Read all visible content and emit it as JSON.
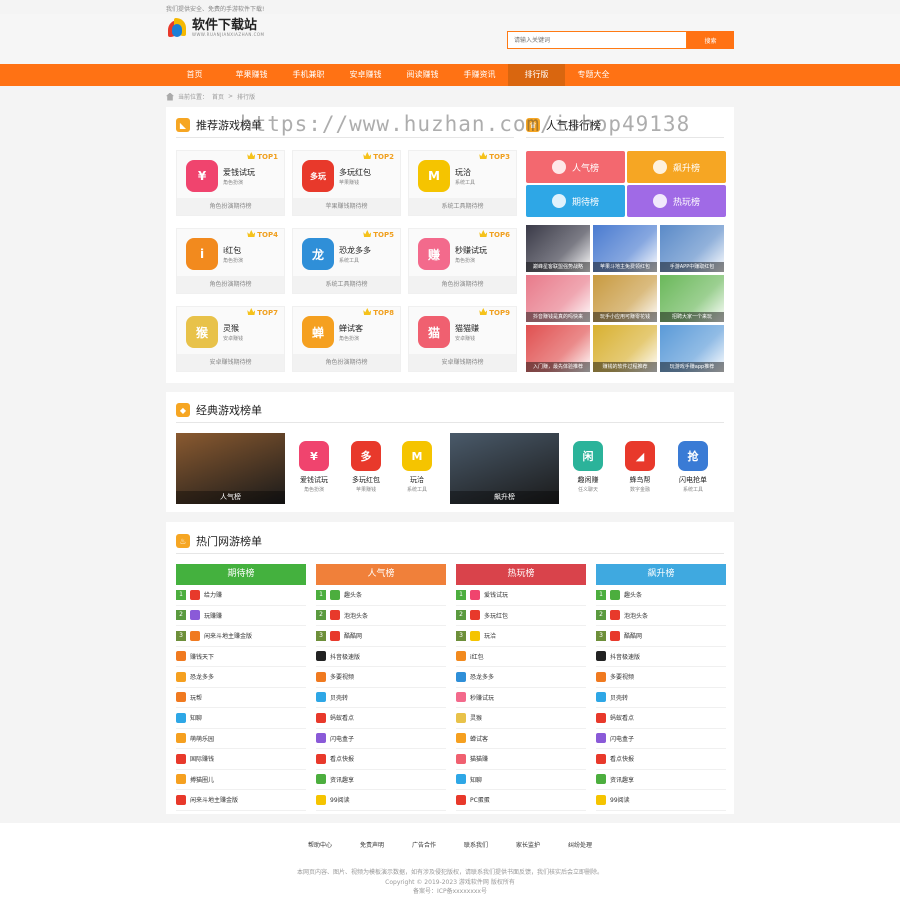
{
  "topnote": "我们提供安全、免费的手游软件下载!",
  "logo": {
    "title": "软件下载站",
    "subtitle": "WWW.RUANJIANXIAZHAN.COM"
  },
  "search": {
    "placeholder": "请输入关键词",
    "button": "搜索"
  },
  "nav": [
    "首页",
    "苹果赚钱",
    "手机兼职",
    "安卓赚钱",
    "阅读赚钱",
    "手赚资讯",
    "排行版",
    "专题大全"
  ],
  "nav_active": "排行版",
  "breadcrumb": {
    "label": "当前位置：",
    "home": "首页",
    "sep": ">",
    "current": "排行版"
  },
  "watermark": "https://www.huzhan.com/ishop49138",
  "recommend": {
    "title": "推荐游戏榜单",
    "cards": [
      {
        "rank": "TOP1",
        "name": "爱钱试玩",
        "sub": "角色扮演",
        "footer": "角色扮演期待榜",
        "icon": "wallet-icon",
        "color": "#f0446e",
        "glyph": "¥"
      },
      {
        "rank": "TOP2",
        "name": "多玩红包",
        "sub": "苹果赚钱",
        "footer": "苹果赚钱期待榜",
        "icon": "red-envelope-icon",
        "color": "#e8392b",
        "glyph": "多玩"
      },
      {
        "rank": "TOP3",
        "name": "玩洽",
        "sub": "系统工具",
        "footer": "系统工具期待榜",
        "icon": "wanqia-icon",
        "color": "#f5c400",
        "glyph": "M"
      },
      {
        "rank": "TOP4",
        "name": "i红包",
        "sub": "角色扮演",
        "footer": "角色扮演期待榜",
        "icon": "i-hongbao-icon",
        "color": "#f28a1e",
        "glyph": "i"
      },
      {
        "rank": "TOP5",
        "name": "恐龙多多",
        "sub": "系统工具",
        "footer": "系统工具期待榜",
        "icon": "dinosaur-icon",
        "color": "#2f8fd8",
        "glyph": "龙"
      },
      {
        "rank": "TOP6",
        "name": "秒赚试玩",
        "sub": "角色扮演",
        "footer": "角色扮演期待榜",
        "icon": "miaozhuan-icon",
        "color": "#f36a8c",
        "glyph": "赚"
      },
      {
        "rank": "TOP7",
        "name": "灵猴",
        "sub": "安卓赚钱",
        "footer": "安卓赚钱期待榜",
        "icon": "monkey-icon",
        "color": "#e8c24a",
        "glyph": "猴"
      },
      {
        "rank": "TOP8",
        "name": "蝉试客",
        "sub": "角色扮演",
        "footer": "角色扮演期待榜",
        "icon": "chanshike-icon",
        "color": "#f5a020",
        "glyph": "蝉"
      },
      {
        "rank": "TOP9",
        "name": "猫猫赚",
        "sub": "安卓赚钱",
        "footer": "安卓赚钱期待榜",
        "icon": "cat-icon",
        "color": "#f06070",
        "glyph": "猫"
      }
    ]
  },
  "popular": {
    "title": "人气排行榜",
    "buttons": [
      {
        "label": "人气榜",
        "color": "#f3686f",
        "icon": "trophy-icon"
      },
      {
        "label": "飙升榜",
        "color": "#f6a623",
        "icon": "rocket-icon"
      },
      {
        "label": "期待榜",
        "color": "#2ea7e6",
        "icon": "heart-icon"
      },
      {
        "label": "热玩榜",
        "color": "#a06ae6",
        "icon": "flame-icon"
      }
    ],
    "thumbs": [
      {
        "caption": "巅峰星客联盟强势战略",
        "color": "#3a3a48"
      },
      {
        "caption": "苹果斗地主免费领红包",
        "color": "#4a7bd0"
      },
      {
        "caption": "手游APP中赚取红包",
        "color": "#5a8ac8"
      },
      {
        "caption": "抖音赚钱是真的吗快来",
        "color": "#e87a8a"
      },
      {
        "caption": "玩手小应用可赚零花钱",
        "color": "#c89a40"
      },
      {
        "caption": "招聘大家一个来玩",
        "color": "#6ab85a"
      },
      {
        "caption": "入门赚，最先体验推荐",
        "color": "#e05050"
      },
      {
        "caption": "赚钱的软件过程推荐",
        "color": "#d8b030"
      },
      {
        "caption": "玩游戏手赚app推荐",
        "color": "#5a9ad8"
      }
    ]
  },
  "classic": {
    "title": "经典游戏榜单",
    "banners": [
      {
        "caption": "人气榜",
        "color": "#8a5a30"
      },
      {
        "caption": "飙升榜",
        "color": "#4a5a6a"
      }
    ],
    "items": [
      {
        "name": "爱钱试玩",
        "sub": "角色扮演",
        "icon": "wallet-icon",
        "color": "#f0446e",
        "glyph": "¥"
      },
      {
        "name": "多玩红包",
        "sub": "苹果赚钱",
        "icon": "red-envelope-icon",
        "color": "#e8392b",
        "glyph": "多"
      },
      {
        "name": "玩洽",
        "sub": "系统工具",
        "icon": "wanqia-icon",
        "color": "#f5c400",
        "glyph": "M"
      },
      {
        "name": "趣闲赚",
        "sub": "任义聊天",
        "icon": "quxianzhuan-icon",
        "color": "#2bb39a",
        "glyph": "闲"
      },
      {
        "name": "蜂鸟帮",
        "sub": "数字金融",
        "icon": "bird-icon",
        "color": "#e8392b",
        "glyph": "◢"
      },
      {
        "name": "闪电抢单",
        "sub": "系统工具",
        "icon": "lightning-icon",
        "color": "#3a7bd5",
        "glyph": "抢"
      }
    ]
  },
  "hot": {
    "title": "热门网游榜单",
    "columns": [
      {
        "header": "期待榜",
        "color": "#44b13e",
        "items": [
          {
            "name": "给力赚",
            "ic": "#e8392b"
          },
          {
            "name": "玩赚赚",
            "ic": "#8a5ad8"
          },
          {
            "name": "闲来斗地主赚金版",
            "ic": "#f07a20"
          },
          {
            "name": "赚钱天下",
            "ic": "#f07a20"
          },
          {
            "name": "恐龙多多",
            "ic": "#f5a020"
          },
          {
            "name": "玩帮",
            "ic": "#f07a20"
          },
          {
            "name": "知聊",
            "ic": "#2ea7e6"
          },
          {
            "name": "萌萌乐园",
            "ic": "#f5a020"
          },
          {
            "name": "国际赚钱",
            "ic": "#e8392b"
          },
          {
            "name": "搏猫圈儿",
            "ic": "#f5a020"
          },
          {
            "name": "闲来斗地主赚金版",
            "ic": "#e8392b"
          }
        ]
      },
      {
        "header": "人气榜",
        "color": "#f0803a",
        "items": [
          {
            "name": "趣头条",
            "ic": "#4cae3e"
          },
          {
            "name": "泡泡头条",
            "ic": "#e8392b"
          },
          {
            "name": "酷酷网",
            "ic": "#e8392b"
          },
          {
            "name": "抖音极速版",
            "ic": "#222"
          },
          {
            "name": "多要视频",
            "ic": "#f07a20"
          },
          {
            "name": "贝壳转",
            "ic": "#2ea7e6"
          },
          {
            "name": "蚂蚁看点",
            "ic": "#e8392b"
          },
          {
            "name": "闪电盒子",
            "ic": "#8a5ad8"
          },
          {
            "name": "看点快报",
            "ic": "#e8392b"
          },
          {
            "name": "资讯趣享",
            "ic": "#4cae3e"
          },
          {
            "name": "99阅读",
            "ic": "#f5c400"
          }
        ]
      },
      {
        "header": "热玩榜",
        "color": "#d9434b",
        "items": [
          {
            "name": "爱钱试玩",
            "ic": "#f0446e"
          },
          {
            "name": "多玩红包",
            "ic": "#e8392b"
          },
          {
            "name": "玩洽",
            "ic": "#f5c400"
          },
          {
            "name": "i红包",
            "ic": "#f28a1e"
          },
          {
            "name": "恐龙多多",
            "ic": "#2f8fd8"
          },
          {
            "name": "秒赚试玩",
            "ic": "#f36a8c"
          },
          {
            "name": "灵猴",
            "ic": "#e8c24a"
          },
          {
            "name": "蝉试客",
            "ic": "#f5a020"
          },
          {
            "name": "猫猫赚",
            "ic": "#f06070"
          },
          {
            "name": "知聊",
            "ic": "#2ea7e6"
          },
          {
            "name": "PC蛋蛋",
            "ic": "#e8392b"
          }
        ]
      },
      {
        "header": "飙升榜",
        "color": "#3fa9e0",
        "items": [
          {
            "name": "趣头条",
            "ic": "#4cae3e"
          },
          {
            "name": "泡泡头条",
            "ic": "#e8392b"
          },
          {
            "name": "酷酷网",
            "ic": "#e8392b"
          },
          {
            "name": "抖音极速版",
            "ic": "#222"
          },
          {
            "name": "多要视频",
            "ic": "#f07a20"
          },
          {
            "name": "贝壳转",
            "ic": "#2ea7e6"
          },
          {
            "name": "蚂蚁看点",
            "ic": "#e8392b"
          },
          {
            "name": "闪电盒子",
            "ic": "#8a5ad8"
          },
          {
            "name": "看点快报",
            "ic": "#e8392b"
          },
          {
            "name": "资讯趣享",
            "ic": "#4cae3e"
          },
          {
            "name": "99阅读",
            "ic": "#f5c400"
          }
        ]
      }
    ]
  },
  "footer": {
    "links": [
      "帮助中心",
      "免责声明",
      "广告合作",
      "联系我们",
      "家长监护",
      "纠纷处理"
    ],
    "line1": "本网页内容、图片、视频为模板演示数据，如有涉及侵犯版权，请联系我们提供书面反馈，我们核实后会立即删除。",
    "line2": "Copyright © 2019-2023 游戏软件网 版权所有",
    "line3": "备案号：ICP备xxxxxxxx号"
  }
}
